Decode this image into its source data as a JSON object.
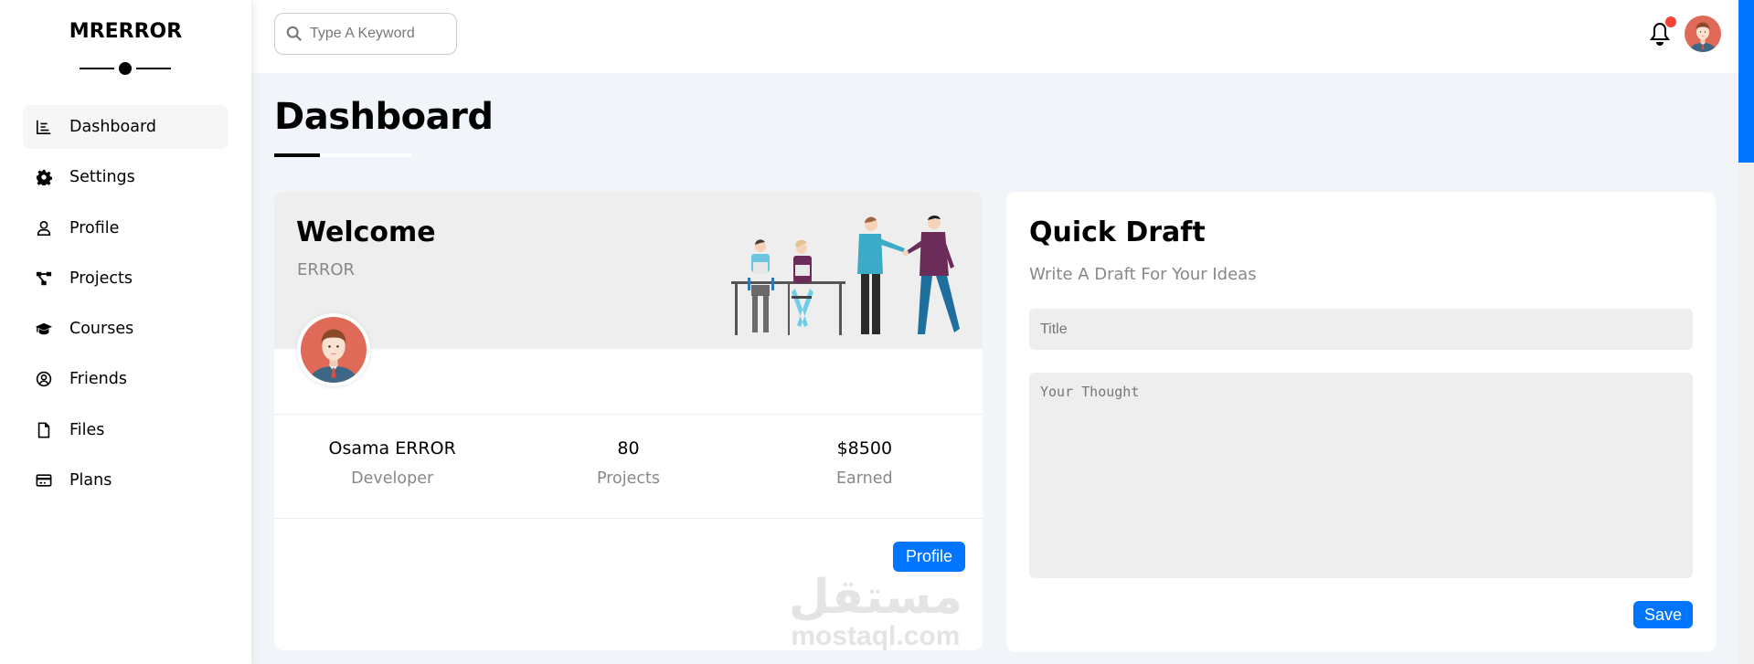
{
  "sidebar": {
    "brand": "MRERROR",
    "items": [
      {
        "label": "Dashboard",
        "icon": "chart-line-icon",
        "active": true
      },
      {
        "label": "Settings",
        "icon": "gear-icon",
        "active": false
      },
      {
        "label": "Profile",
        "icon": "user-icon",
        "active": false
      },
      {
        "label": "Projects",
        "icon": "diagram-project-icon",
        "active": false
      },
      {
        "label": "Courses",
        "icon": "graduation-cap-icon",
        "active": false
      },
      {
        "label": "Friends",
        "icon": "user-circle-icon",
        "active": false
      },
      {
        "label": "Files",
        "icon": "file-icon",
        "active": false
      },
      {
        "label": "Plans",
        "icon": "credit-card-icon",
        "active": false
      }
    ]
  },
  "header": {
    "search_placeholder": "Type A Keyword",
    "notification_badge_color": "#f44336"
  },
  "page": {
    "title": "Dashboard"
  },
  "welcome": {
    "title": "Welcome",
    "subtitle": "ERROR",
    "stats": [
      {
        "value": "Osama ERROR",
        "label": "Developer"
      },
      {
        "value": "80",
        "label": "Projects"
      },
      {
        "value": "$8500",
        "label": "Earned"
      }
    ],
    "button_label": "Profile",
    "watermark_ar": "مستقل",
    "watermark_en": "mostaql.com"
  },
  "draft": {
    "title": "Quick Draft",
    "subtitle": "Write A Draft For Your Ideas",
    "title_placeholder": "Title",
    "body_placeholder": "Your Thought",
    "button_label": "Save"
  },
  "colors": {
    "accent": "#0075ff",
    "page_bg": "#f1f5f9",
    "muted_text": "#888888"
  }
}
